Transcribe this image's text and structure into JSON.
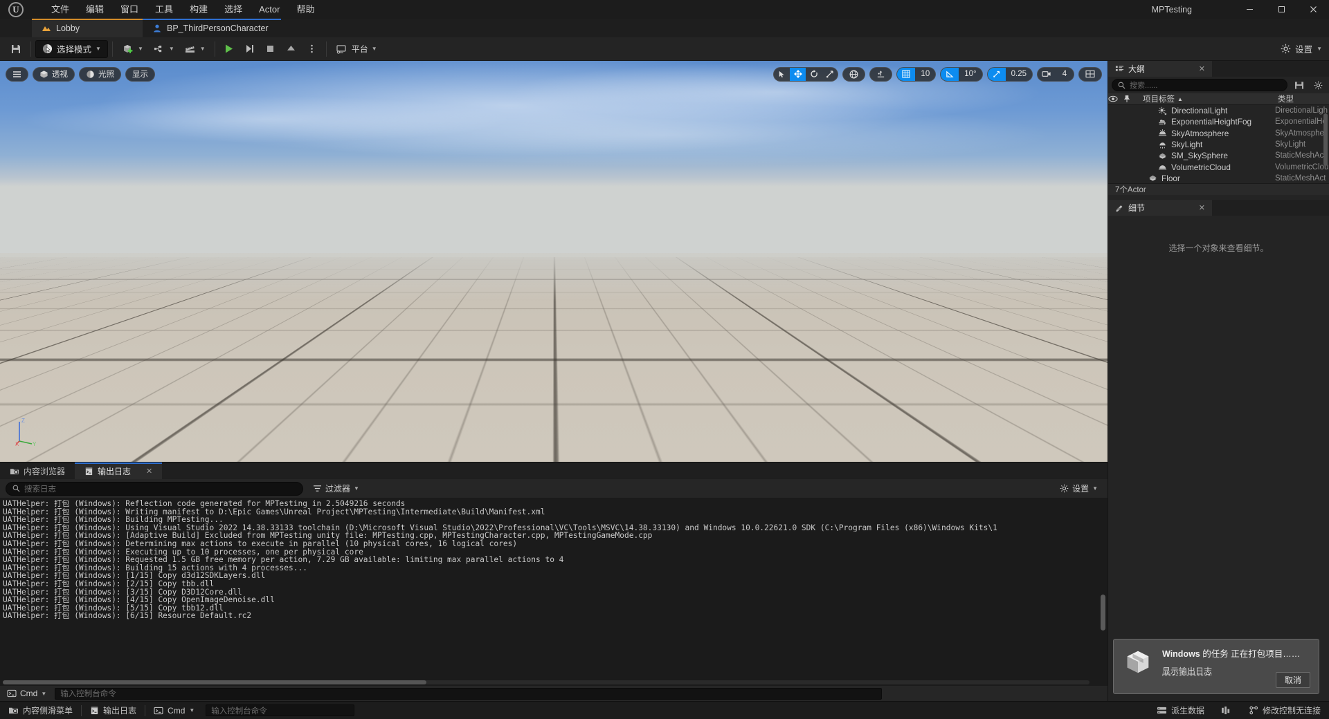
{
  "titlebar": {
    "logo": "unreal-logo",
    "menus": [
      "文件",
      "编辑",
      "窗口",
      "工具",
      "构建",
      "选择",
      "Actor",
      "帮助"
    ],
    "project_name": "MPTesting",
    "window_buttons": [
      "最小化",
      "还原",
      "关闭"
    ]
  },
  "level_tabs": [
    {
      "label": "Lobby",
      "icon": "level-icon",
      "active": true
    },
    {
      "label": "BP_ThirdPersonCharacter",
      "icon": "blueprint-icon",
      "active": false
    }
  ],
  "toolbar": {
    "save_label": "",
    "mode_label": "选择模式",
    "platform_label": "平台",
    "settings_label": "设置",
    "play_tooltip": "运行",
    "actors_tooltip": "快速添加",
    "blueprints_tooltip": "蓝图",
    "cinematics_tooltip": "过场动画"
  },
  "viewport": {
    "left_chips": [
      {
        "label": "",
        "icon": "menu-icon"
      },
      {
        "label": "透视",
        "icon": "cube-icon"
      },
      {
        "label": "光照",
        "icon": "lit-icon"
      },
      {
        "label": "显示",
        "icon": ""
      }
    ],
    "transform_tools": [
      {
        "icon": "select-arrow-icon",
        "active": false
      },
      {
        "icon": "move-icon",
        "active": true
      },
      {
        "icon": "rotate-icon",
        "active": false
      },
      {
        "icon": "scale-icon",
        "active": false
      }
    ],
    "coord_icon": "globe-icon",
    "snap_toggle_icon": "surface-snap-icon",
    "grid_snap": "10",
    "angle_snap": "10°",
    "scale_snap": "0.25",
    "camera_speed": "4",
    "layout_icon": "viewport-layout-icon",
    "gizmo_axes": [
      "Z",
      "Y",
      "X"
    ]
  },
  "outliner": {
    "tab_label": "大纲",
    "search_placeholder": "搜索......",
    "columns": {
      "visibility": "eye-icon",
      "pin": "pin-icon",
      "label": "项目标签",
      "sort": "▲",
      "type": "类型"
    },
    "items": [
      {
        "name": "DirectionalLight",
        "type": "DirectionalLigh",
        "icon": "directional-light-icon",
        "indent": 1
      },
      {
        "name": "ExponentialHeightFog",
        "type": "ExponentialHe",
        "icon": "fog-icon",
        "indent": 1
      },
      {
        "name": "SkyAtmosphere",
        "type": "SkyAtmospher",
        "icon": "sky-atmosphere-icon",
        "indent": 1
      },
      {
        "name": "SkyLight",
        "type": "SkyLight",
        "icon": "sky-light-icon",
        "indent": 1
      },
      {
        "name": "SM_SkySphere",
        "type": "StaticMeshAct",
        "icon": "static-mesh-icon",
        "indent": 1
      },
      {
        "name": "VolumetricCloud",
        "type": "VolumetricClou",
        "icon": "volumetric-cloud-icon",
        "indent": 1
      },
      {
        "name": "Floor",
        "type": "StaticMeshAct",
        "icon": "static-mesh-icon",
        "indent": 0
      }
    ],
    "footer": "7个Actor"
  },
  "details": {
    "tab_label": "细节",
    "empty_message": "选择一个对象来查看细节。"
  },
  "bottom_panel": {
    "tabs": [
      {
        "label": "内容浏览器",
        "icon": "content-browser-icon",
        "active": false
      },
      {
        "label": "输出日志",
        "icon": "output-log-icon",
        "active": true
      }
    ],
    "search_placeholder": "搜索日志",
    "filter_label": "过滤器",
    "settings_label": "设置",
    "cmd_label": "Cmd",
    "cmd_placeholder": "输入控制台命令",
    "log_lines": [
      "UATHelper: 打包 (Windows): Reflection code generated for MPTesting in 2.5049216 seconds",
      "UATHelper: 打包 (Windows): Writing manifest to D:\\Epic Games\\Unreal Project\\MPTesting\\Intermediate\\Build\\Manifest.xml",
      "UATHelper: 打包 (Windows): Building MPTesting...",
      "UATHelper: 打包 (Windows): Using Visual Studio 2022 14.38.33133 toolchain (D:\\Microsoft Visual Studio\\2022\\Professional\\VC\\Tools\\MSVC\\14.38.33130) and Windows 10.0.22621.0 SDK (C:\\Program Files (x86)\\Windows Kits\\1",
      "UATHelper: 打包 (Windows): [Adaptive Build] Excluded from MPTesting unity file: MPTesting.cpp, MPTestingCharacter.cpp, MPTestingGameMode.cpp",
      "UATHelper: 打包 (Windows): Determining max actions to execute in parallel (10 physical cores, 16 logical cores)",
      "UATHelper: 打包 (Windows):   Executing up to 10 processes, one per physical core",
      "UATHelper: 打包 (Windows):   Requested 1.5 GB free memory per action, 7.29 GB available: limiting max parallel actions to 4",
      "UATHelper: 打包 (Windows): Building 15 actions with 4 processes...",
      "UATHelper: 打包 (Windows): [1/15] Copy d3d12SDKLayers.dll",
      "UATHelper: 打包 (Windows): [2/15] Copy tbb.dll",
      "UATHelper: 打包 (Windows): [3/15] Copy D3D12Core.dll",
      "UATHelper: 打包 (Windows): [4/15] Copy OpenImageDenoise.dll",
      "UATHelper: 打包 (Windows): [5/15] Copy tbb12.dll",
      "UATHelper: 打包 (Windows): [6/15] Resource Default.rc2"
    ]
  },
  "statusbar": {
    "content_drawer": "内容侧滑菜单",
    "output_log": "输出日志",
    "cmd_label": "Cmd",
    "cmd_placeholder": "输入控制台命令",
    "derived_data": "派生数据",
    "revision_control": "修改控制无连接"
  },
  "toast": {
    "icon": "package-icon",
    "title_bold": "Windows",
    "title_rest": " 的任务 正在打包项目……",
    "link": "显示输出日志",
    "cancel": "取消"
  },
  "colors": {
    "accent_blue": "#0d8cf0",
    "tab_orange": "#d48c2a",
    "panel_bg": "#242424",
    "window_bg": "#1c1c1c",
    "play_green": "#5fc04a"
  }
}
